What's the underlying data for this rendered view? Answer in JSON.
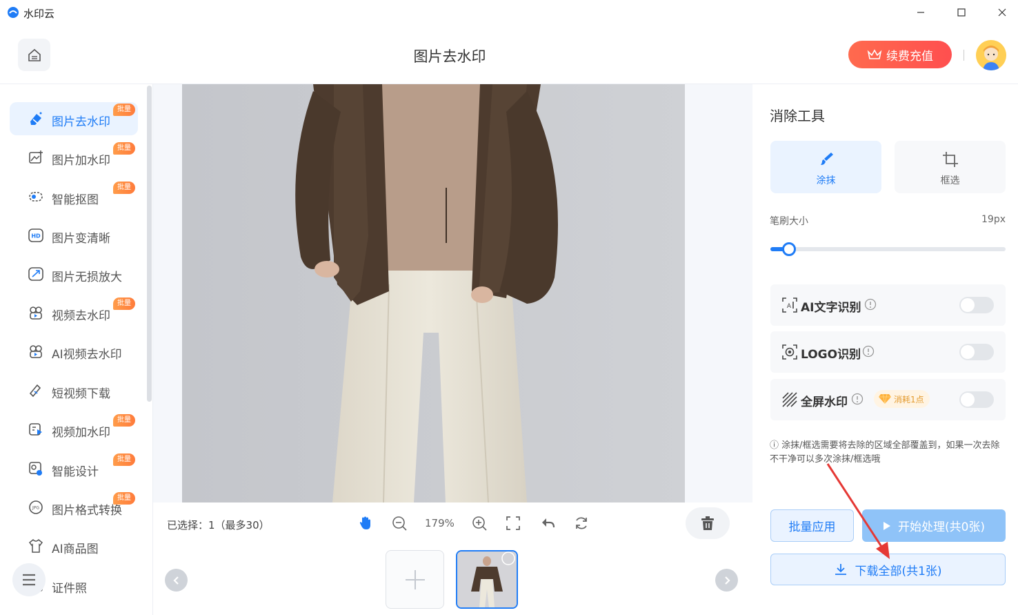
{
  "app": {
    "title": "水印云"
  },
  "header": {
    "page_title": "图片去水印",
    "renew_label": "续费充值"
  },
  "sidebar": {
    "items": [
      {
        "label": "图片去水印",
        "icon": "eraser-icon",
        "badge": "批量",
        "active": true
      },
      {
        "label": "图片加水印",
        "icon": "image-add-icon",
        "badge": "批量"
      },
      {
        "label": "智能抠图",
        "icon": "cutout-icon",
        "badge": "批量"
      },
      {
        "label": "图片变清晰",
        "icon": "hd-icon",
        "badge": ""
      },
      {
        "label": "图片无损放大",
        "icon": "enlarge-icon",
        "badge": ""
      },
      {
        "label": "视频去水印",
        "icon": "video-icon",
        "badge": "批量"
      },
      {
        "label": "AI视频去水印",
        "icon": "ai-video-icon",
        "badge": ""
      },
      {
        "label": "短视频下载",
        "icon": "link-icon",
        "badge": ""
      },
      {
        "label": "视频加水印",
        "icon": "video-add-icon",
        "badge": "批量"
      },
      {
        "label": "智能设计",
        "icon": "design-icon",
        "badge": "批量"
      },
      {
        "label": "图片格式转换",
        "icon": "jpg-icon",
        "badge": "批量"
      },
      {
        "label": "AI商品图",
        "icon": "shirt-icon",
        "badge": ""
      },
      {
        "label": "证件照",
        "icon": "id-photo-icon",
        "badge": ""
      }
    ]
  },
  "toolbar": {
    "selection": "已选择：1（最多30）",
    "zoom": "179%"
  },
  "panel": {
    "title": "消除工具",
    "tools": [
      {
        "label": "涂抹",
        "icon": "brush-icon",
        "active": true
      },
      {
        "label": "框选",
        "icon": "crop-icon",
        "active": false
      }
    ],
    "brush_label": "笔刷大小",
    "brush_value": "19px",
    "brush_fraction": 0.08,
    "options": [
      {
        "label": "AI文字识别",
        "icon": "ai-text-icon",
        "enabled": false
      },
      {
        "label": "LOGO识别",
        "icon": "logo-detect-icon",
        "enabled": false
      },
      {
        "label": "全屏水印",
        "icon": "fullscreen-watermark-icon",
        "cost": "消耗1点",
        "enabled": false
      }
    ],
    "note": "ⓘ 涂抹/框选需要将去除的区域全部覆盖到，如果一次去除不干净可以多次涂抹/框选哦",
    "batch_apply": "批量应用",
    "start": "开始处理(共0张)",
    "download": "下载全部(共1张)"
  },
  "colors": {
    "accent": "#1f7cf6",
    "badge": "#ff8a40",
    "renew": "#ff5a4e",
    "arrow": "#e53935"
  }
}
